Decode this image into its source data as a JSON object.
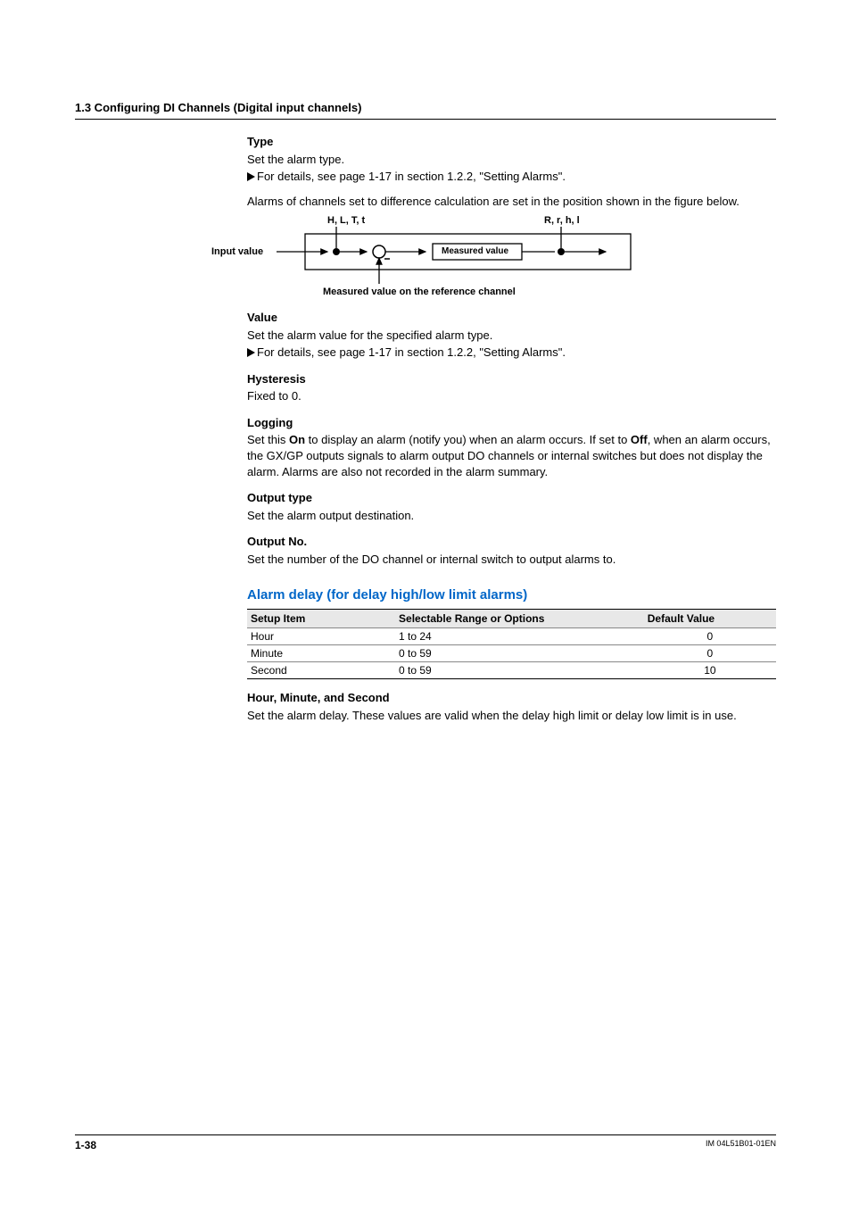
{
  "header": {
    "section": "1.3  Configuring DI Channels (Digital input channels)"
  },
  "type": {
    "title": "Type",
    "line1": "Set the alarm type.",
    "ref": "For details, see page 1-17 in section 1.2.2, \"Setting Alarms\".",
    "para2": "Alarms of channels set to difference calculation are set in the position shown in the figure below."
  },
  "diagram": {
    "left_label": "H, L, T, t",
    "right_label": "R, r, h, l",
    "input": "Input value",
    "measured": "Measured value",
    "caption": "Measured value on the reference channel"
  },
  "value": {
    "title": "Value",
    "line1": "Set the alarm value for the specified alarm type.",
    "ref": "For details, see page 1-17 in section 1.2.2, \"Setting Alarms\"."
  },
  "hysteresis": {
    "title": "Hysteresis",
    "line1": "Fixed to 0."
  },
  "logging": {
    "title": "Logging",
    "pre": "Set this ",
    "on": "On",
    "mid": " to display an alarm (notify you) when an alarm occurs. If set to ",
    "off": "Off",
    "post": ", when an alarm occurs, the GX/GP outputs signals to alarm output DO channels or internal switches but does not display the alarm. Alarms are also not recorded in the alarm summary."
  },
  "outtype": {
    "title": "Output type",
    "line1": "Set the alarm output destination."
  },
  "outno": {
    "title": "Output No.",
    "line1": "Set the number of the DO channel or internal switch to output alarms to."
  },
  "alarmdelay": {
    "title": "Alarm delay (for delay high/low limit alarms)",
    "headers": {
      "c1": "Setup Item",
      "c2": "Selectable Range or Options",
      "c3": "Default Value"
    },
    "rows": [
      {
        "item": "Hour",
        "range": "1 to 24",
        "def": "0"
      },
      {
        "item": "Minute",
        "range": "0 to 59",
        "def": "0"
      },
      {
        "item": "Second",
        "range": "0 to 59",
        "def": "10"
      }
    ],
    "subhead": "Hour, Minute, and Second",
    "subpara": "Set the alarm delay. These values are valid when the delay high limit or delay low limit is in use."
  },
  "footer": {
    "page": "1-38",
    "doc": "IM 04L51B01-01EN"
  }
}
